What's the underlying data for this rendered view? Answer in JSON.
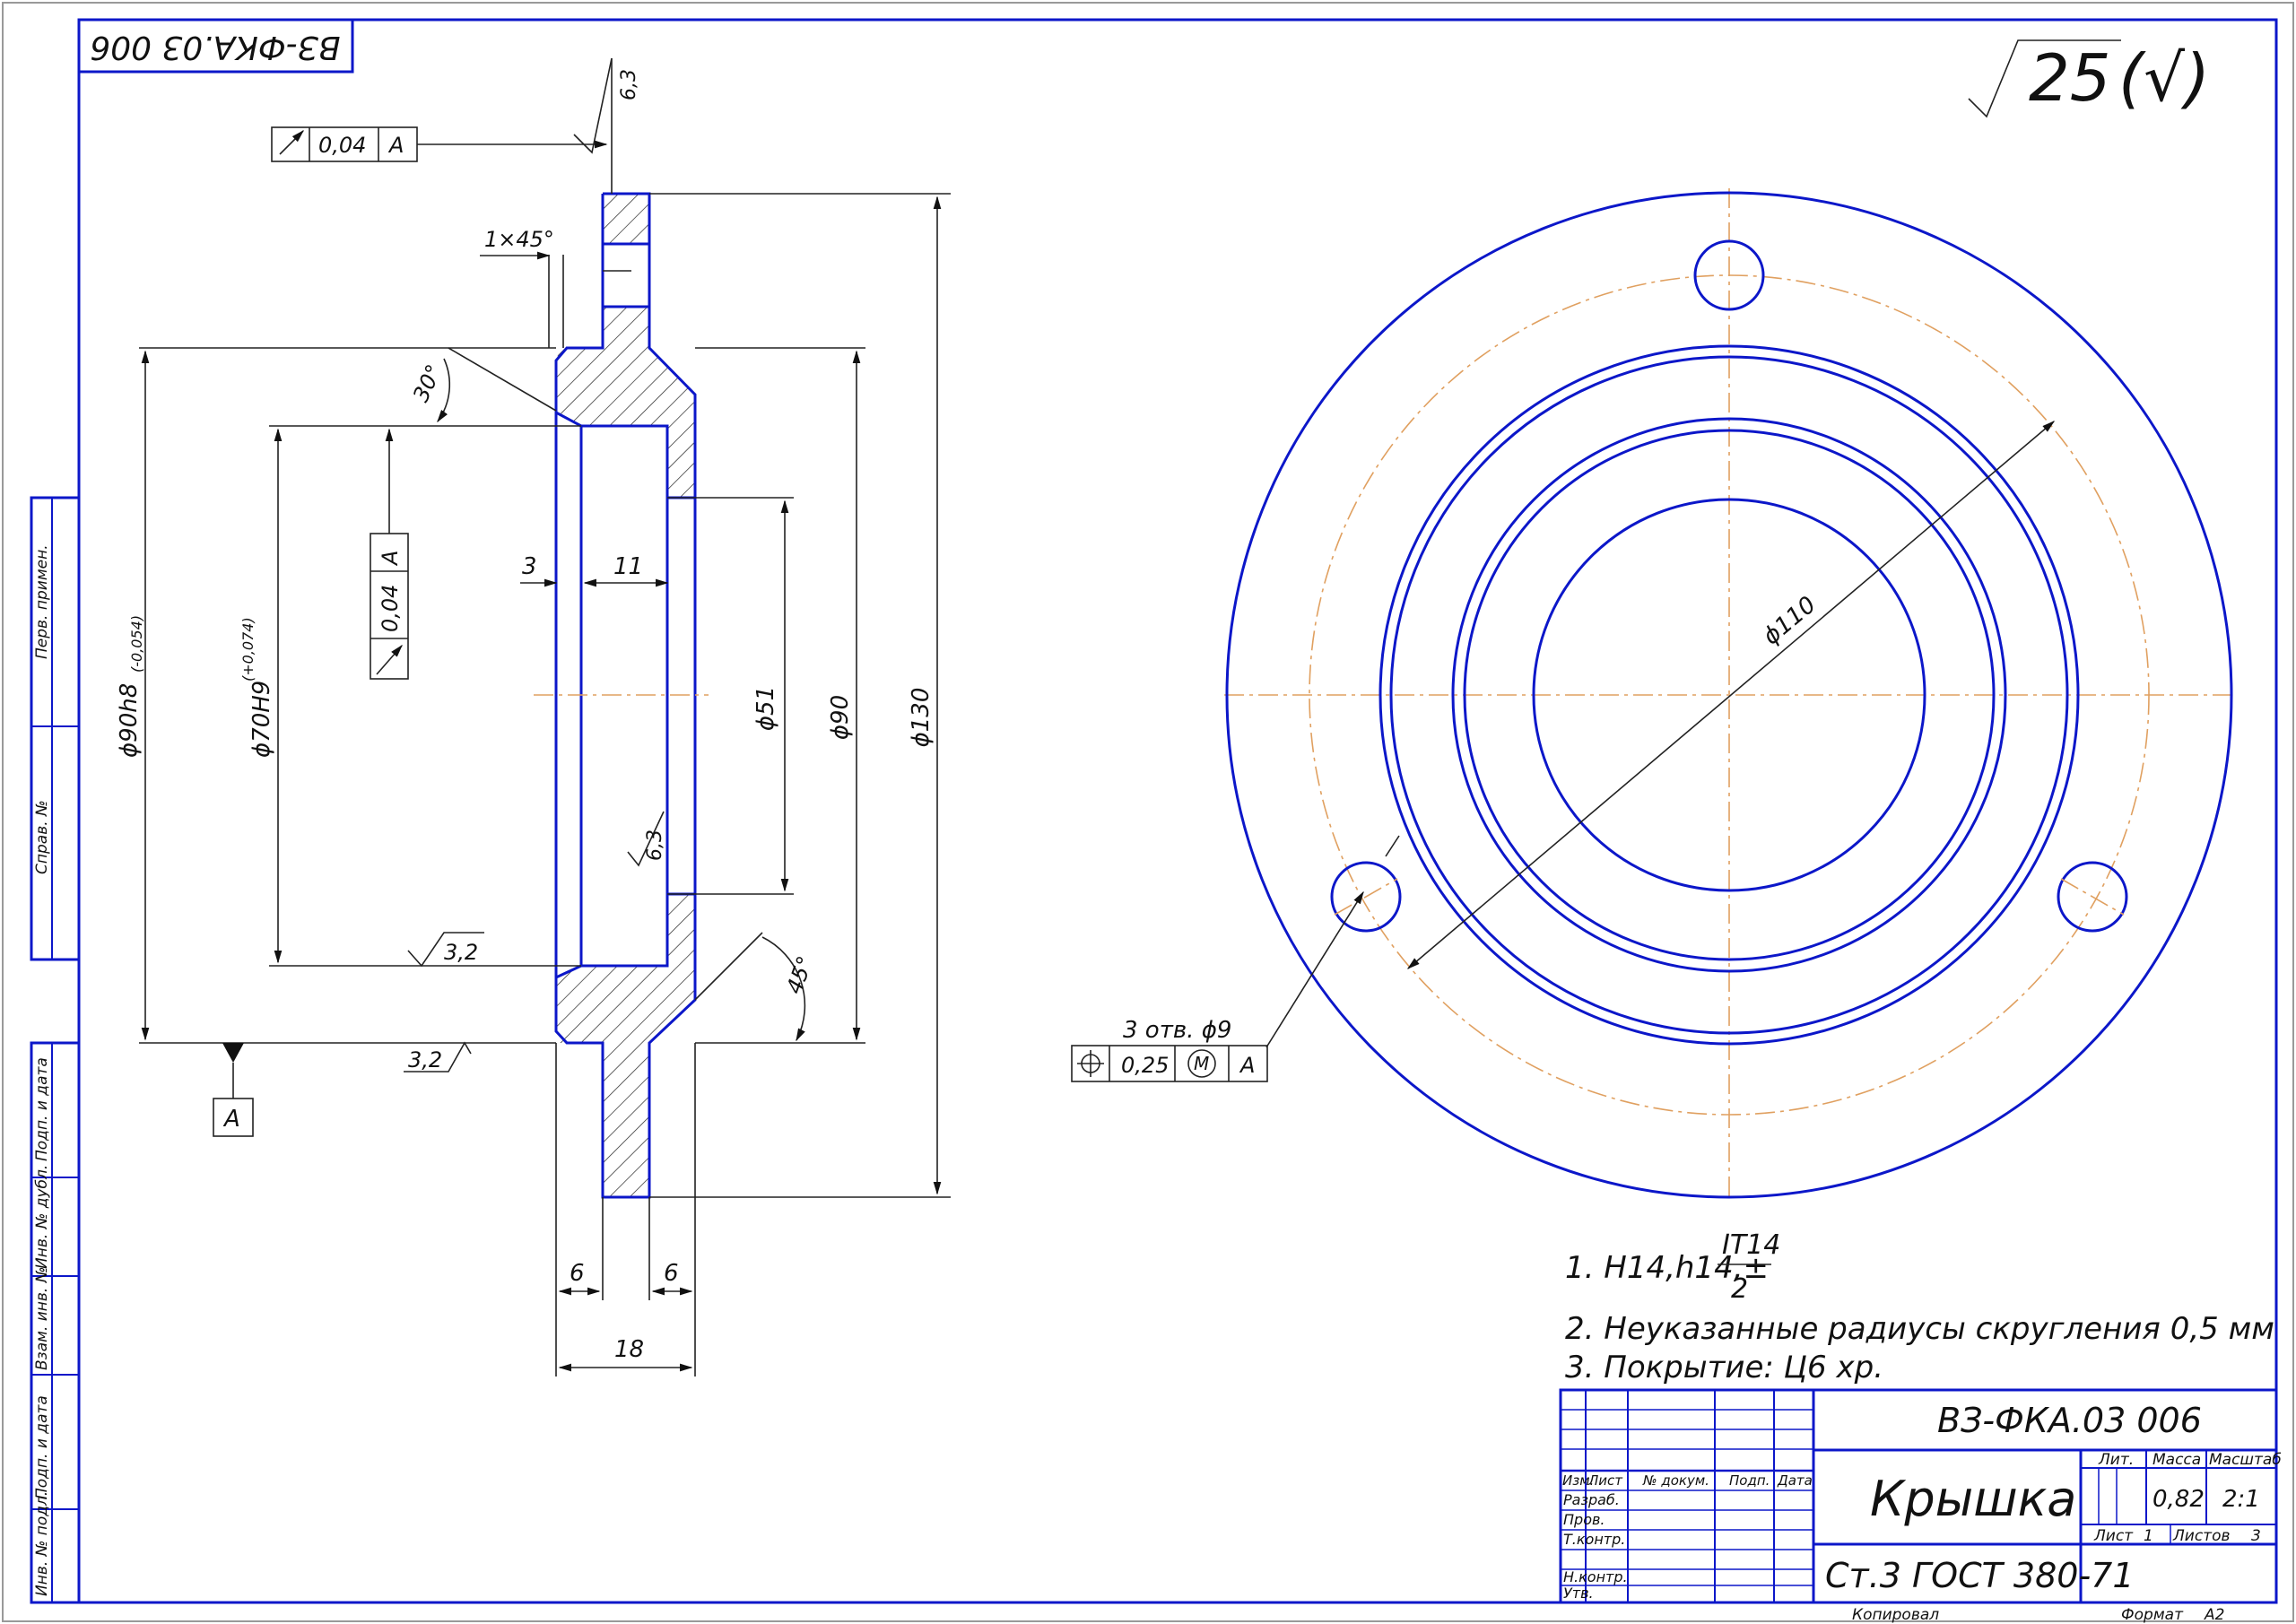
{
  "drawing": {
    "code_top": "ВЗ-ФКА.03 006",
    "roughness_general": "25",
    "roughness_general_suffix": "(√)",
    "ref_datum": "A"
  },
  "dims": {
    "chamfer": "1×45°",
    "angle30": "30°",
    "angle45": "45°",
    "d90_main": "ϕ90h8",
    "d90_tol": "(-0,054)",
    "d70_main": "ϕ70H9",
    "d70_tol": "(+0,074)",
    "d51": "ϕ51",
    "d90": "ϕ90",
    "d130": "ϕ130",
    "d110": "ϕ110",
    "w3": "3",
    "w11": "11",
    "w6a": "6",
    "w6b": "6",
    "w18": "18",
    "rough63_top": "6,3",
    "rough63_mid": "6,3",
    "rough32_a": "3,2",
    "rough32_b": "3,2"
  },
  "tolerances": {
    "runout_top": {
      "value": "0,04",
      "datum": "A"
    },
    "runout_side": {
      "value": "0,04",
      "datum": "A"
    },
    "holes_note": "3 отв. ϕ9",
    "position": {
      "value": "0,25",
      "modifier": "M",
      "datum": "A"
    }
  },
  "notes": {
    "n1_prefix": "1. H14,h14,±",
    "n1_num": "IT14",
    "n1_den": "2",
    "n2": "2. Неуказанные радиусы скругления 0,5 мм",
    "n3": "3. Покрытие: Ц6 хр."
  },
  "side_stamp": [
    "Перв. примен.",
    "Справ. №",
    "Подп. и дата",
    "Инв. № дубл.",
    "Взам. инв. №",
    "Подп. и дата",
    "Инв. № подл."
  ],
  "title_block": {
    "designation": "ВЗ-ФКА.03 006",
    "name": "Крышка",
    "material": "Ст.3 ГОСТ 380-71",
    "head_izm": "Изм.",
    "head_list": "Лист",
    "head_doc": "№ докум.",
    "head_podp": "Подп.",
    "head_data": "Дата",
    "row_razrab": "Разраб.",
    "row_prov": "Пров.",
    "row_tkontr": "Т.контр.",
    "row_nkontr": "Н.контр.",
    "row_utv": "Утв.",
    "lit_label": "Лит.",
    "mass_label": "Масса",
    "scale_label": "Масштаб",
    "mass": "0,82",
    "scale": "2:1",
    "sheet_label": "Лист",
    "sheet_no": "1",
    "sheets_label": "Листов",
    "sheets_no": "3",
    "copied": "Копировал",
    "format_label": "Формат",
    "format": "A2"
  }
}
